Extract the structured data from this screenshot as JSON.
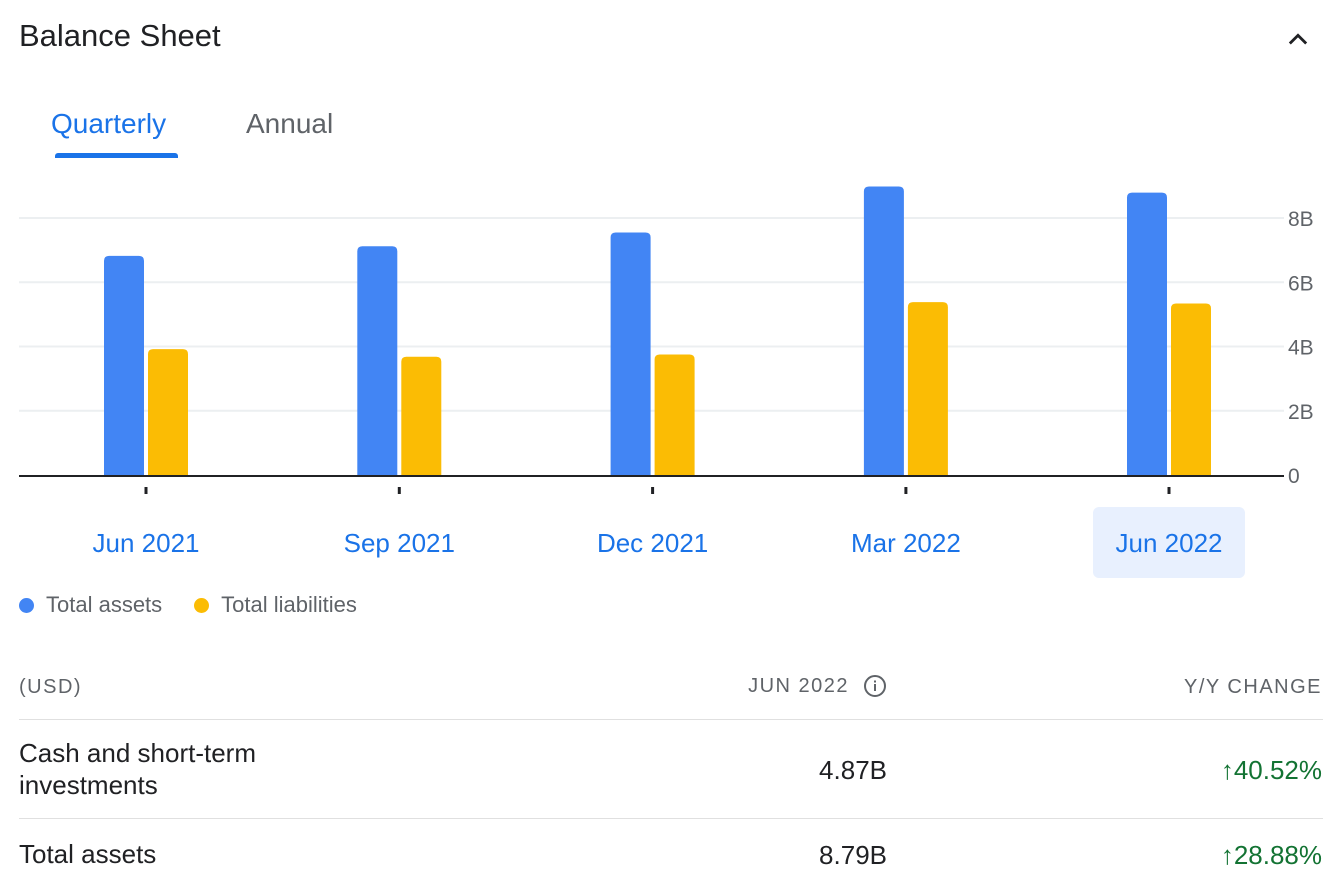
{
  "section": {
    "title": "Balance Sheet"
  },
  "tabs": [
    {
      "label": "Quarterly",
      "active": true
    },
    {
      "label": "Annual",
      "active": false
    }
  ],
  "colors": {
    "assets": "#4285f4",
    "liabilities": "#fbbc04",
    "accent": "#1a73e8",
    "positive": "#137333",
    "selected_bg": "#e8f0fe"
  },
  "chart_data": {
    "type": "bar",
    "categories": [
      "Jun 2021",
      "Sep 2021",
      "Dec 2021",
      "Mar 2022",
      "Jun 2022"
    ],
    "selected_category": "Jun 2022",
    "series": [
      {
        "name": "Total assets",
        "values": [
          6.82,
          7.12,
          7.55,
          8.98,
          8.79
        ]
      },
      {
        "name": "Total liabilities",
        "values": [
          3.92,
          3.68,
          3.75,
          5.38,
          5.34
        ]
      }
    ],
    "y_ticks": [
      "0",
      "2B",
      "4B",
      "6B",
      "8B"
    ],
    "y_tick_values": [
      0,
      2,
      4,
      6,
      8
    ],
    "ylim": [
      0,
      8
    ],
    "y_axis_position": "right",
    "grid": true,
    "legend_position": "bottom-left"
  },
  "legend": [
    {
      "label": "Total assets",
      "icon": "blue-dot"
    },
    {
      "label": "Total liabilities",
      "icon": "yellow-dot"
    }
  ],
  "table": {
    "headers": {
      "label": "(USD)",
      "value": "JUN 2022",
      "change": "Y/Y CHANGE"
    },
    "rows": [
      {
        "label_line1": "Cash and short-term",
        "label_line2": "investments",
        "value": "4.87B",
        "change": "40.52%"
      },
      {
        "label": "Total assets",
        "value": "8.79B",
        "change": "28.88%"
      }
    ]
  }
}
